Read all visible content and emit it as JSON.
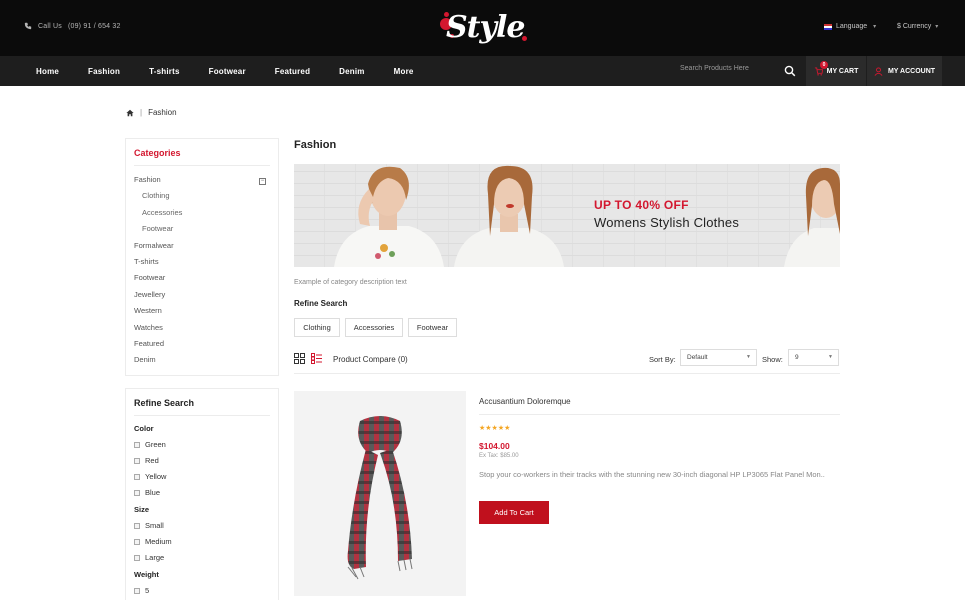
{
  "topbar": {
    "call_label": "Call Us",
    "phone": "(09) 91 / 654 32",
    "logo_text": "Style",
    "language": "Language",
    "currency": "$ Currency"
  },
  "nav": {
    "items": [
      "Home",
      "Fashion",
      "T-shirts",
      "Footwear",
      "Featured",
      "Denim",
      "More"
    ],
    "search_placeholder": "Search Products Here",
    "cart_count": "0",
    "cart_label": "MY CART",
    "account_label": "MY ACCOUNT"
  },
  "breadcrumb": {
    "separator": "|",
    "current": "Fashion"
  },
  "sidebar": {
    "categories_title": "Categories",
    "categories": [
      {
        "label": "Fashion",
        "level": 0
      },
      {
        "label": "Clothing",
        "level": 1
      },
      {
        "label": "Accessories",
        "level": 1
      },
      {
        "label": "Footwear",
        "level": 1
      },
      {
        "label": "Formalwear",
        "level": 0
      },
      {
        "label": "T-shirts",
        "level": 0
      },
      {
        "label": "Footwear",
        "level": 0
      },
      {
        "label": "Jewellery",
        "level": 0
      },
      {
        "label": "Western",
        "level": 0
      },
      {
        "label": "Watches",
        "level": 0
      },
      {
        "label": "Featured",
        "level": 0
      },
      {
        "label": "Denim",
        "level": 0
      }
    ],
    "collapse_symbol": "−",
    "refine_title": "Refine Search",
    "color_label": "Color",
    "colors": [
      "Green",
      "Red",
      "Yellow",
      "Blue"
    ],
    "size_label": "Size",
    "sizes": [
      "Small",
      "Medium",
      "Large"
    ],
    "weight_label": "Weight",
    "weights": [
      "5"
    ]
  },
  "main": {
    "title": "Fashion",
    "banner_line1": "UP TO 40% OFF",
    "banner_line2": "Womens Stylish Clothes",
    "description": "Example of category description text",
    "refine_label": "Refine Search",
    "subcategories": [
      "Clothing",
      "Accessories",
      "Footwear"
    ],
    "product_compare": "Product Compare (0)",
    "sort_label": "Sort By:",
    "sort_value": "Default",
    "show_label": "Show:",
    "show_value": "9"
  },
  "product": {
    "name": "Accusantium Doloremque",
    "rating": 5,
    "stars": "★★★★★",
    "price": "$104.00",
    "ex_tax": "Ex Tax: $85.00",
    "description": "Stop your co-workers in their tracks with the stunning new 30-inch diagonal HP LP3065 Flat Panel Mon..",
    "add_to_cart": "Add To Cart"
  },
  "colors": {
    "accent": "#d3172f",
    "topbar_bg": "#0b0b0b",
    "navbar_bg": "#1e1e1e"
  }
}
